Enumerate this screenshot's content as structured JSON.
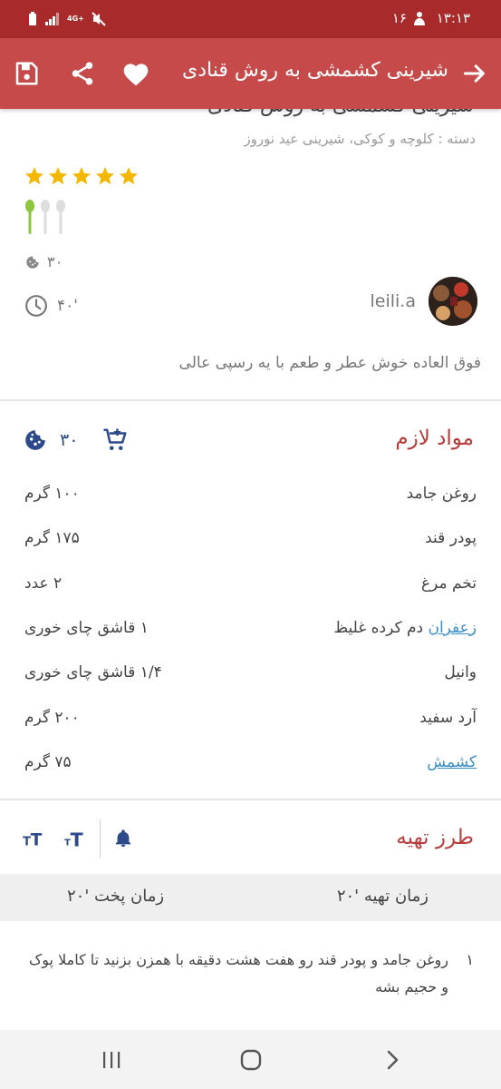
{
  "status_bar": {
    "time": "۱۳:۱۳",
    "date": "۱۶",
    "network": "4G+"
  },
  "app_bar": {
    "title": "شیرینی کشمشی به روش قنادی",
    "icons": [
      "arrow-right-icon",
      "heart-icon",
      "share-icon",
      "save-icon"
    ]
  },
  "recipe": {
    "title": "شیرینی کشمشی به روش قنادی",
    "category": "دسته : کلوچه و کوکی، شیرینی عید نوروز",
    "rating": 5,
    "difficulty": 1,
    "servings": "۳۰",
    "time": "۴۰'",
    "author": "leili.a",
    "description": "فوق العاده خوش عطر و طعم با یه رسپی عالی"
  },
  "ingredients": {
    "title": "مواد لازم",
    "servings": "۳۰",
    "items": [
      {
        "name": "روغن جامد",
        "link": "",
        "amount": "۱۰۰ گرم"
      },
      {
        "name": "پودر قند",
        "link": "",
        "amount": "۱۷۵ گرم"
      },
      {
        "name": "تخم مرغ",
        "link": "",
        "amount": "۲ عدد"
      },
      {
        "name": " دم کرده غلیظ",
        "link": "زعفران",
        "amount": "۱ قاشق چای خوری"
      },
      {
        "name": "وانیل",
        "link": "",
        "amount": "۱/۴ قاشق چای خوری"
      },
      {
        "name": "آرد سفید",
        "link": "",
        "amount": "۲۰۰ گرم"
      },
      {
        "name": "",
        "link": "کشمش",
        "amount": "۷۵ گرم"
      }
    ]
  },
  "preparation": {
    "title": "طرز تهیه",
    "prep_time": "زمان تهیه '۲۰",
    "cook_time": "زمان پخت '۲۰",
    "steps": [
      {
        "number": "۱",
        "text": "روغن جامد و پودر قند رو هفت هشت دقیقه با همزن بزنید تا کاملا پوک و حجیم بشه"
      }
    ]
  },
  "colors": {
    "status_bar": "#a82a2a",
    "app_bar": "#c64a4a",
    "section_title": "#b73b3b",
    "link": "#3b8fc8",
    "tool_icons": "#2c4a8a",
    "star": "#f5b800",
    "spoon_active": "#8cc63f"
  }
}
